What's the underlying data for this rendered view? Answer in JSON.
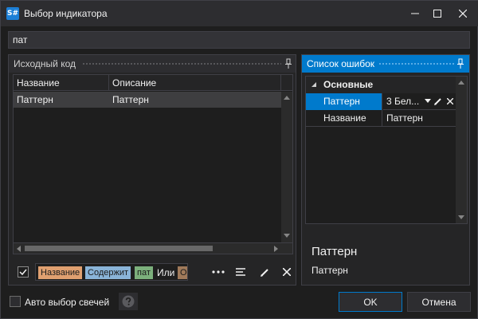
{
  "window": {
    "title": "Выбор индикатора",
    "app_icon_text": "S#"
  },
  "search": {
    "value": "пат"
  },
  "left_panel": {
    "title": "Исходный код",
    "columns": [
      "Название",
      "Описание"
    ],
    "rows": [
      {
        "name": "Паттерн",
        "description": "Паттерн"
      }
    ]
  },
  "filter": {
    "checked": true,
    "tokens": {
      "field": "Название",
      "operator": "Содержит",
      "value": "пат",
      "logic": "Или",
      "next_field": "Оп"
    }
  },
  "right_panel": {
    "title": "Список ошибок",
    "category": "Основные",
    "properties": [
      {
        "name": "Паттерн",
        "value": "3 Бел..."
      },
      {
        "name": "Название",
        "value": "Паттерн"
      }
    ],
    "description_title": "Паттерн",
    "description_text": "Паттерн"
  },
  "bottom": {
    "auto_select_label": "Авто выбор свечей",
    "ok_label": "OK",
    "cancel_label": "Отмена"
  },
  "colors": {
    "accent": "#007acc",
    "token_field": "#e0a070",
    "token_operator": "#8ab4d8",
    "token_value": "#7cb07c",
    "token_next": "#a07a5a"
  }
}
